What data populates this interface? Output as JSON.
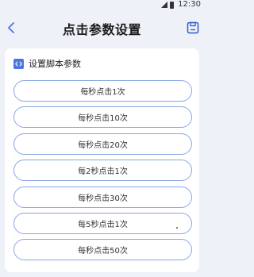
{
  "status_bar": {
    "time": "12:30"
  },
  "header": {
    "title": "点击参数设置"
  },
  "section": {
    "title": "设置脚本参数"
  },
  "options": [
    {
      "label": "每秒点击1次"
    },
    {
      "label": "每秒点击10次"
    },
    {
      "label": "每秒点击20次"
    },
    {
      "label": "每2秒点击1次"
    },
    {
      "label": "每秒点击30次"
    },
    {
      "label": "每5秒点击1次"
    },
    {
      "label": "每秒点击50次"
    }
  ],
  "colors": {
    "accent": "#4a78e0",
    "button_border": "#8aa6e3",
    "background": "#eef1f7"
  },
  "icons": {
    "back": "chevron-left-icon",
    "save": "save-icon",
    "section": "code-icon",
    "signal": "signal-icon",
    "battery": "battery-icon"
  }
}
